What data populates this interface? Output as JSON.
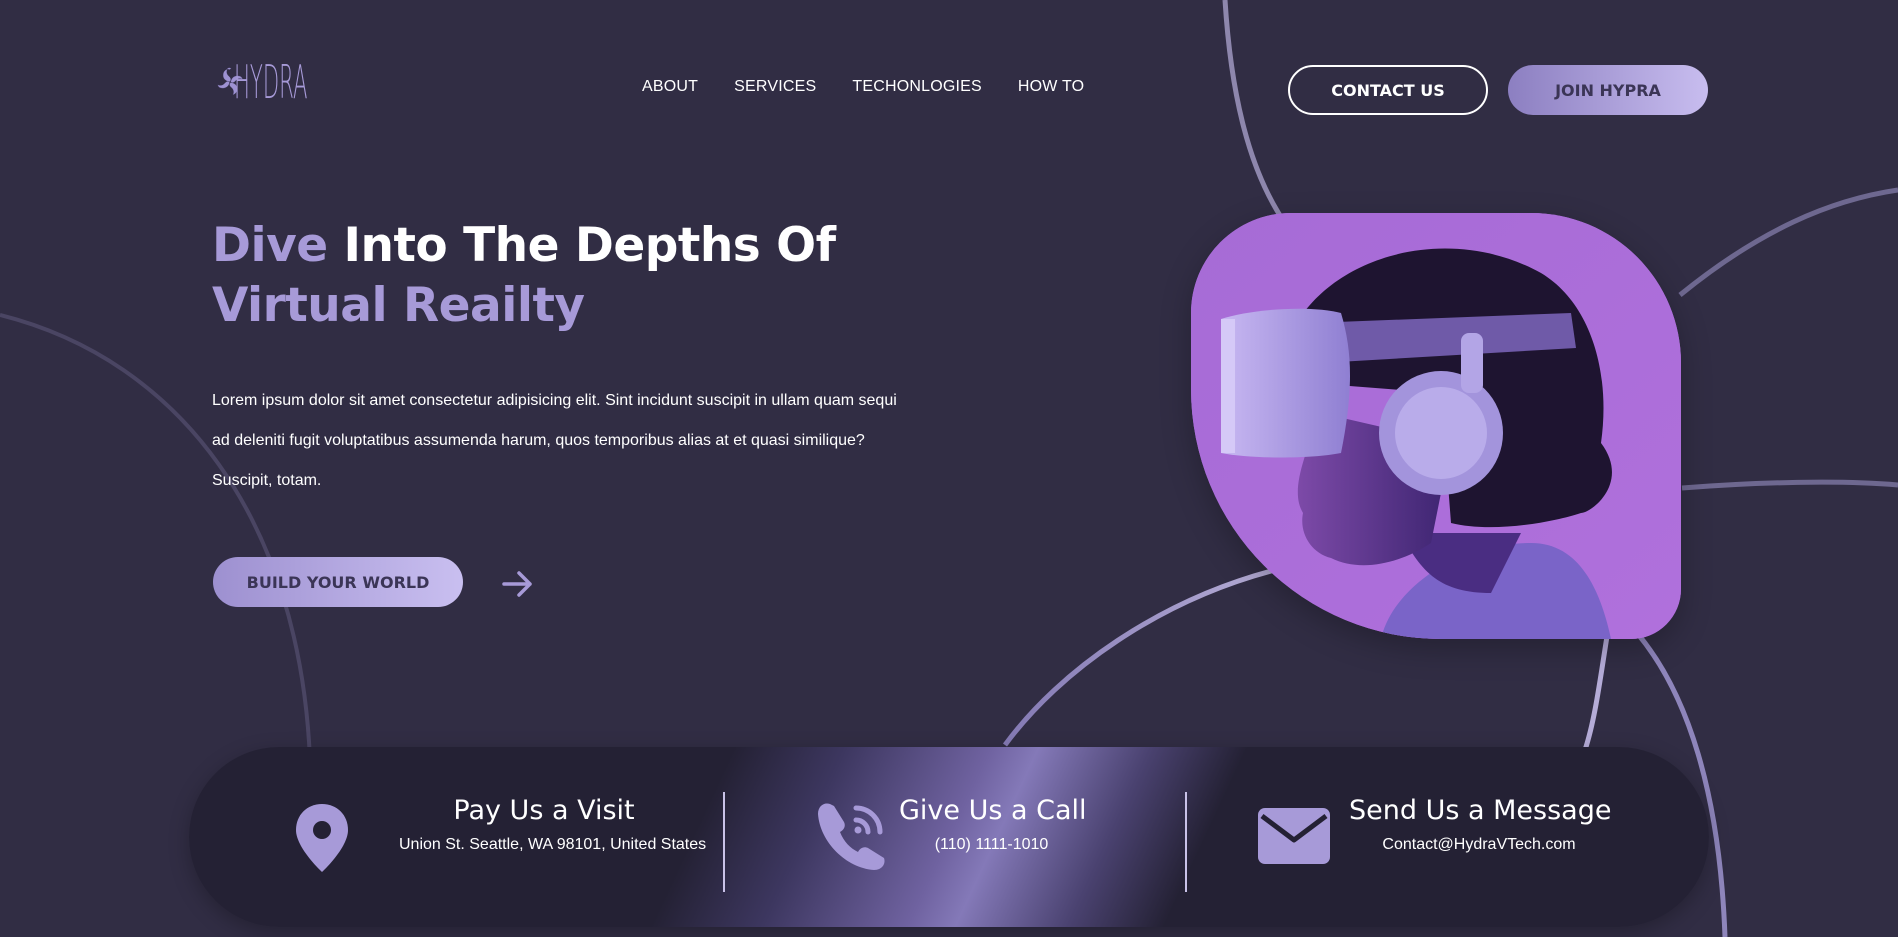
{
  "brand": {
    "logo_text": "HYDRA",
    "accent_color": "#a79ad8",
    "background_color": "#312d44"
  },
  "nav": {
    "items": [
      {
        "label": "ABOUT"
      },
      {
        "label": "SERVICES"
      },
      {
        "label": "TECHONLOGIES"
      },
      {
        "label": "HOW TO"
      }
    ]
  },
  "header": {
    "contact_label": "CONTACT US",
    "join_label": "JOIN HYPRA"
  },
  "hero": {
    "title_accent_1": "Dive",
    "title_white": " Into The Depths Of",
    "title_accent_2": "Virtual Reailty",
    "body": "Lorem ipsum dolor sit amet consectetur adipisicing elit. Sint incidunt suscipit in ullam quam sequi ad deleniti fugit voluptatibus assumenda harum, quos temporibus alias at et quasi similique? Suscipit, totam.",
    "cta_label": "BUILD YOUR WORLD",
    "arrow_icon": "arrow-right-icon",
    "image_subject": "person-wearing-vr-headset"
  },
  "contact": {
    "visit": {
      "title": "Pay Us a Visit",
      "detail": "Union St. Seattle, WA 98101, United States",
      "icon": "map-pin-icon"
    },
    "call": {
      "title": "Give Us a Call",
      "detail": "(110) 1111-1010",
      "icon": "phone-icon"
    },
    "message": {
      "title": "Send Us a Message",
      "detail": "Contact@HydraVTech.com",
      "icon": "envelope-icon"
    }
  }
}
